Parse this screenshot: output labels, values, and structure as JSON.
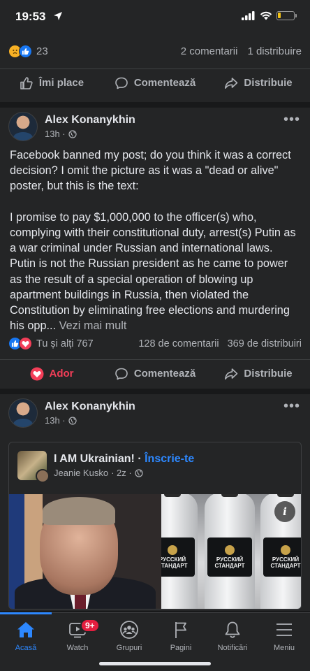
{
  "status_bar": {
    "time": "19:53",
    "battery_level": 0.2
  },
  "top_post": {
    "reaction_count": "23",
    "comments": "2 comentarii",
    "shares": "1 distribuire",
    "actions": {
      "like": "Îmi place",
      "comment": "Comentează",
      "share": "Distribuie"
    }
  },
  "post1": {
    "author": "Alex Konanykhin",
    "time": "13h ·",
    "text": "Facebook banned my post; do you think it was a correct decision? I omit the picture as it was a \"dead or alive\" poster, but this is the text:\n\nI promise to pay $1,000,000 to the officer(s) who, complying with their constitutional duty, arrest(s) Putin as a war criminal under Russian and international laws. Putin is not the Russian president as he came to power as the result of a special operation of blowing up apartment buildings in Russia, then violated the Constitution by eliminating free elections and murdering his opp... ",
    "see_more": "Vezi mai mult",
    "reactions": "Tu și alți 767",
    "comments": "128 de comentarii",
    "shares": "369 de distribuiri",
    "actions": {
      "like": "Ador",
      "comment": "Comentează",
      "share": "Distribuie"
    }
  },
  "post2": {
    "author": "Alex Konanykhin",
    "time": "13h ·",
    "group_name": "I AM Ukrainian!",
    "group_sep": " · ",
    "group_join": "Înscrie-te",
    "group_author": "Jeanie Kusko",
    "group_time": "· 2z ·",
    "bottle_label": "РУССКИЙ СТАНДАРТ",
    "info_icon": "i"
  },
  "nav": {
    "items": [
      {
        "label": "Acasă",
        "icon": "home-icon"
      },
      {
        "label": "Watch",
        "icon": "video-icon",
        "badge": "9+"
      },
      {
        "label": "Grupuri",
        "icon": "groups-icon"
      },
      {
        "label": "Pagini",
        "icon": "flag-icon"
      },
      {
        "label": "Notificări",
        "icon": "bell-icon"
      },
      {
        "label": "Meniu",
        "icon": "menu-icon"
      }
    ]
  },
  "colors": {
    "accent": "#2d88ff",
    "love": "#f33e58",
    "background": "#18191a",
    "card": "#242526"
  }
}
